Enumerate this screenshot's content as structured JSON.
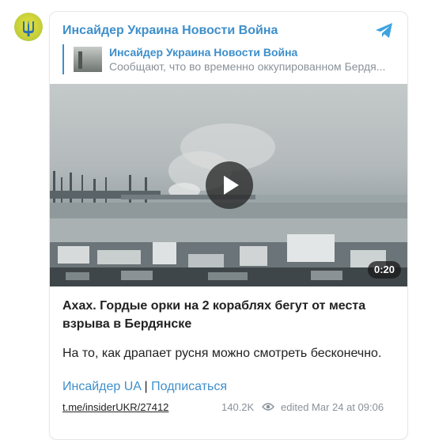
{
  "channel": {
    "title": "Инсайдер Украина Новости Война"
  },
  "reply": {
    "name": "Инсайдер Украина Новости Война",
    "preview": "Сообщают, что во временно оккупированном Бердя..."
  },
  "video": {
    "duration": "0:20"
  },
  "post": {
    "headline": "Ахах. Гордые орки на 2 кораблях бегут от места взрыва в Бердянске",
    "body": "На то, как драпает русня можно смотреть бесконечно.",
    "link_channel": "Инсайдер UA",
    "link_separator": "|",
    "link_subscribe": "Подписаться"
  },
  "footer": {
    "post_link": "t.me/insiderUKR/27412",
    "views": "140.2K",
    "edited": "edited  Mar 24 at 09:06"
  },
  "icons": {
    "telegram": "telegram-plane-icon",
    "play": "play-icon",
    "views": "eye-icon"
  },
  "colors": {
    "accent": "#3e8fcb",
    "text": "#222222",
    "muted": "#8a9299"
  }
}
